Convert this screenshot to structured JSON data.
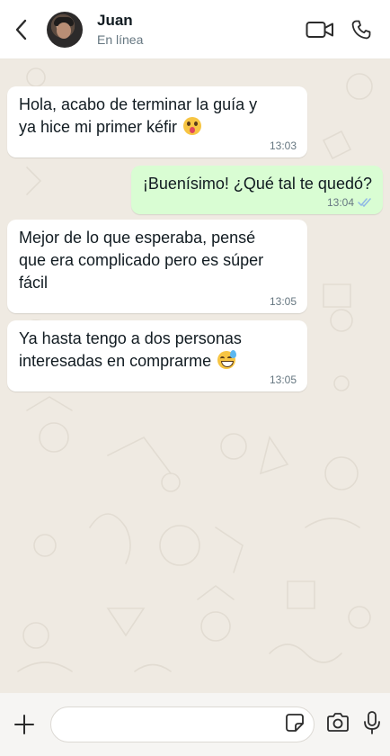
{
  "header": {
    "back_icon": "chevron-left-icon",
    "contact_name": "Juan",
    "status": "En línea",
    "video_icon": "video-camera-icon",
    "call_icon": "phone-icon"
  },
  "messages": [
    {
      "direction": "in",
      "line1": "Hola, acabo de terminar la guía y",
      "line2": "ya hice mi primer kéfir",
      "emoji": "astonished-face",
      "time": "13:03"
    },
    {
      "direction": "out",
      "text": "¡Buenísimo! ¿Qué tal te quedó?",
      "time": "13:04",
      "receipt": "double-check-icon"
    },
    {
      "direction": "in",
      "line1": "Mejor de lo que esperaba, pensé",
      "line2": "que era complicado pero es súper",
      "line3": "fácil",
      "time": "13:05"
    },
    {
      "direction": "in",
      "line1": "Ya hasta tengo a dos personas",
      "line2": "interesadas en comprarme",
      "emoji": "grinning-sweat-face",
      "time": "13:05"
    }
  ],
  "composer": {
    "plus_icon": "plus-icon",
    "input_value": "",
    "sticker_icon": "sticker-icon",
    "camera_icon": "camera-icon",
    "mic_icon": "microphone-icon"
  },
  "colors": {
    "header_bg": "#ffffff",
    "wallpaper": "#efeae2",
    "incoming_bubble": "#ffffff",
    "outgoing_bubble": "#d9fdd3",
    "receipt": "#8fb7e6"
  }
}
